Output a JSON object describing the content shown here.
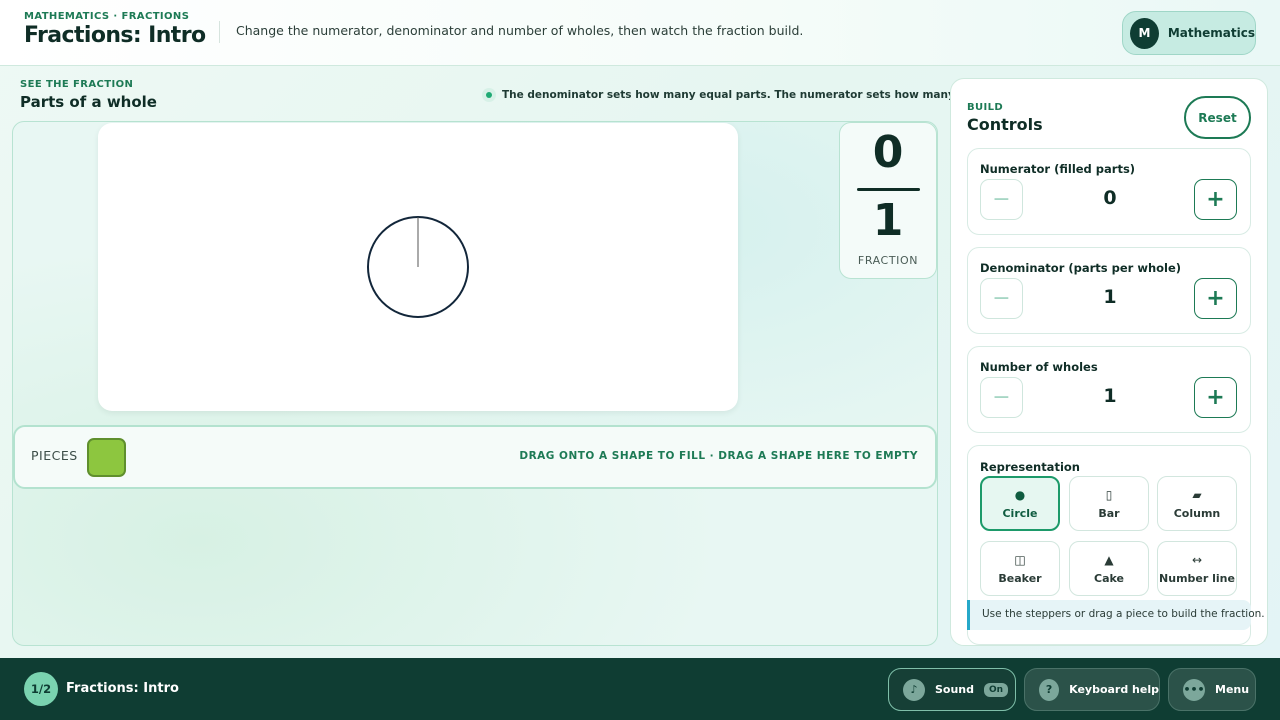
{
  "header": {
    "eyebrow": "MATHEMATICS · FRACTIONS",
    "title": "Fractions: Intro",
    "description": "Change the numerator, denominator and number of wholes, then watch the fraction build.",
    "subject": {
      "avatar_initial": "M",
      "label": "Mathematics"
    }
  },
  "stage": {
    "eyebrow": "SEE THE FRACTION",
    "title": "Parts of a whole",
    "hint": "The denominator sets how many equal parts. The numerator sets how many are filled.",
    "shape": "circle",
    "fraction": {
      "numerator": "0",
      "denominator": "1",
      "label": "FRACTION"
    },
    "tray": {
      "label": "PIECES",
      "piece_color": "#8dc63f",
      "instructions": "DRAG ONTO A SHAPE TO FILL · DRAG A SHAPE HERE TO EMPTY"
    }
  },
  "controls": {
    "eyebrow": "BUILD",
    "title": "Controls",
    "reset_label": "Reset",
    "numerator": {
      "label": "Numerator (filled parts)",
      "value": "0",
      "minus": "−",
      "plus": "+"
    },
    "denominator": {
      "label": "Denominator (parts per whole)",
      "value": "1",
      "minus": "−",
      "plus": "+"
    },
    "wholes": {
      "label": "Number of wholes",
      "value": "1",
      "minus": "−",
      "plus": "+"
    },
    "representation": {
      "label": "Representation",
      "selected": "Circle",
      "options": [
        {
          "label": "Circle",
          "icon": "●",
          "icon_name": "circle-icon"
        },
        {
          "label": "Bar",
          "icon": "▯",
          "icon_name": "bar-icon"
        },
        {
          "label": "Column",
          "icon": "▰",
          "icon_name": "column-icon"
        },
        {
          "label": "Beaker",
          "icon": "◫",
          "icon_name": "beaker-icon"
        },
        {
          "label": "Cake",
          "icon": "▲",
          "icon_name": "cake-icon"
        },
        {
          "label": "Number line",
          "icon": "↔",
          "icon_name": "number-line-icon"
        }
      ]
    },
    "help": "Use the steppers or drag a piece to build the fraction."
  },
  "footer": {
    "step": "1/2",
    "title": "Fractions: Intro",
    "sound": {
      "icon": "♪",
      "label": "Sound",
      "state": "On"
    },
    "keyboard": {
      "icon": "?",
      "label": "Keyboard help"
    },
    "menu": {
      "icon": "•••",
      "label": "Menu"
    }
  },
  "colors": {
    "accent": "#1d7a55",
    "footer_bg": "#0f3d33",
    "piece": "#8dc63f"
  }
}
